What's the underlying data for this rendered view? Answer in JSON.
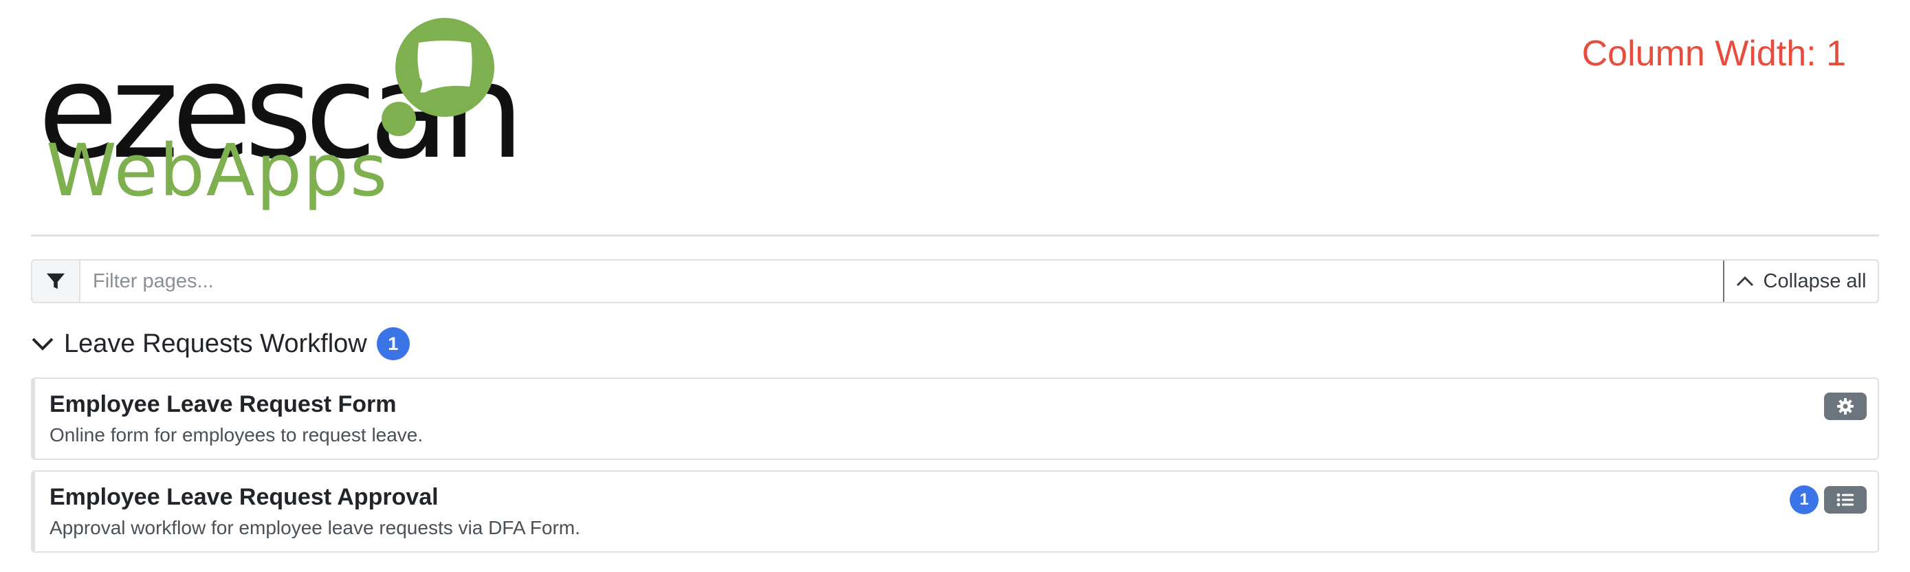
{
  "logo": {
    "wordmark": "ezescan",
    "subtitle": "WebApps",
    "brand_color": "#7fb04f"
  },
  "debug": {
    "column_width_label": "Column Width: 1"
  },
  "filter": {
    "placeholder": "Filter pages...",
    "value": "",
    "icon": "filter-icon",
    "collapse_label": "Collapse all",
    "collapse_icon": "chevron-up-icon"
  },
  "group": {
    "title": "Leave Requests Workflow",
    "count": "1",
    "expanded": true,
    "icon": "chevron-down-icon"
  },
  "pages": [
    {
      "title": "Employee Leave Request Form",
      "description": "Online form for employees to request leave.",
      "action_icon": "gear-icon"
    },
    {
      "title": "Employee Leave Request Approval",
      "description": "Approval workflow for employee leave requests via DFA Form.",
      "badge": "1",
      "action_icon": "list-icon"
    }
  ],
  "colors": {
    "accent_badge": "#3b74e6",
    "secondary_button": "#6c757d",
    "debug_text": "#e74c3c"
  }
}
